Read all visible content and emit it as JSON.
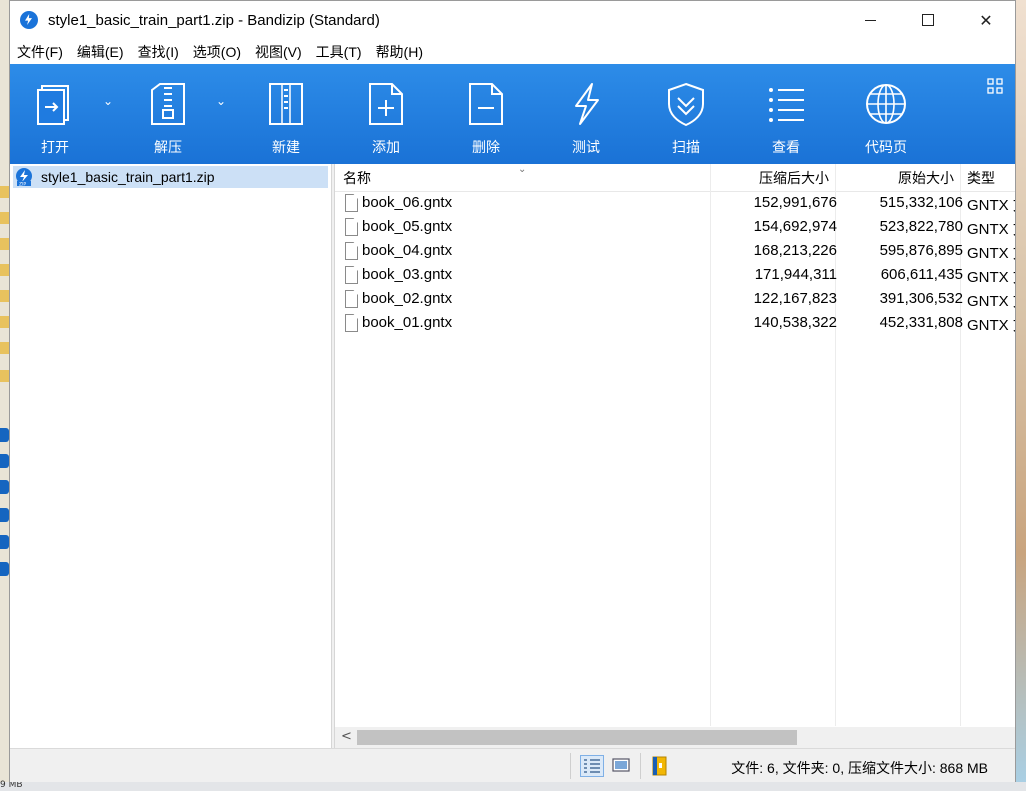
{
  "window": {
    "title": "style1_basic_train_part1.zip - Bandizip (Standard)",
    "close_glyph": "✕"
  },
  "menu": [
    {
      "label": "文件(F)"
    },
    {
      "label": "编辑(E)"
    },
    {
      "label": "查找(I)"
    },
    {
      "label": "选项(O)"
    },
    {
      "label": "视图(V)"
    },
    {
      "label": "工具(T)"
    },
    {
      "label": "帮助(H)"
    }
  ],
  "toolbar": {
    "open": "打开",
    "extract": "解压",
    "new": "新建",
    "add": "添加",
    "delete": "删除",
    "test": "测试",
    "scan": "扫描",
    "view": "查看",
    "codepage": "代码页",
    "dropdown_glyph": "⌄"
  },
  "tree": {
    "root": "style1_basic_train_part1.zip"
  },
  "columns": {
    "name": "名称",
    "compressed": "压缩后大小",
    "original": "原始大小",
    "type": "类型",
    "sort_glyph": "⌄"
  },
  "files": [
    {
      "name": "book_06.gntx",
      "compressed": "152,991,676",
      "original": "515,332,106",
      "type": "GNTX 文件"
    },
    {
      "name": "book_05.gntx",
      "compressed": "154,692,974",
      "original": "523,822,780",
      "type": "GNTX 文件"
    },
    {
      "name": "book_04.gntx",
      "compressed": "168,213,226",
      "original": "595,876,895",
      "type": "GNTX 文件"
    },
    {
      "name": "book_03.gntx",
      "compressed": "171,944,311",
      "original": "606,611,435",
      "type": "GNTX 文件"
    },
    {
      "name": "book_02.gntx",
      "compressed": "122,167,823",
      "original": "391,306,532",
      "type": "GNTX 文件"
    },
    {
      "name": "book_01.gntx",
      "compressed": "140,538,322",
      "original": "452,331,808",
      "type": "GNTX 文件"
    }
  ],
  "scrollbar": {
    "left_glyph": "<"
  },
  "status": {
    "text": "文件: 6, 文件夹: 0, 压缩文件大小: 868 MB"
  },
  "desktop": {
    "bottom_left_text": "9 MB"
  },
  "colors": {
    "toolbar_top": "#2d8ce8",
    "toolbar_bottom": "#1a72d6",
    "selection": "#cce0f6"
  }
}
